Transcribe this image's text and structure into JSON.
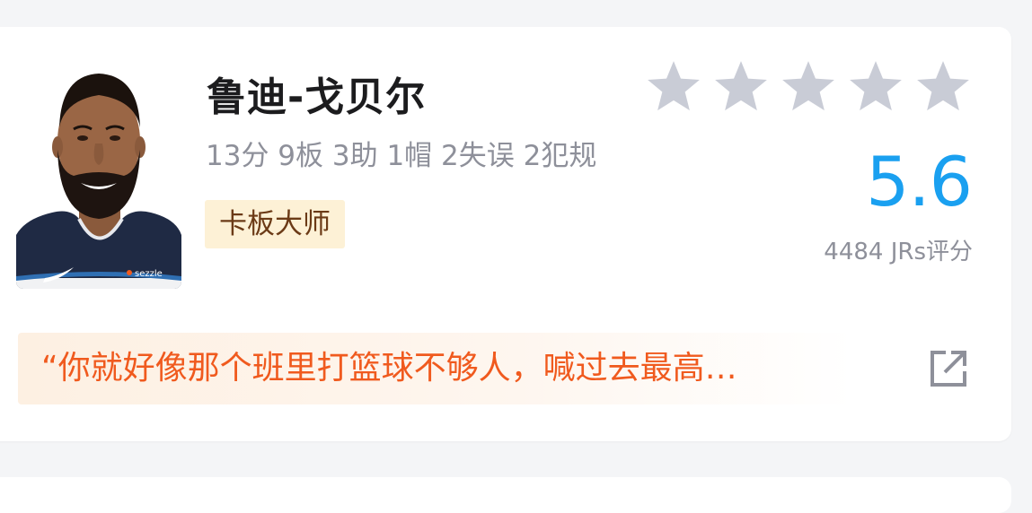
{
  "player": {
    "name": "鲁迪-戈贝尔",
    "stats": "13分 9板 3助 1帽 2失误 2犯规",
    "tag": "卡板大师",
    "jersey_sponsor": "sezzle"
  },
  "rating": {
    "stars_total": 5,
    "stars_filled": 0,
    "score": "5.6",
    "raters": "4484 JRs评分"
  },
  "comment": {
    "text": "“你就好像那个班里打篮球不够人，喊过去最高…"
  },
  "colors": {
    "score": "#1aa0f0",
    "star_empty": "#c9ccd6",
    "quote_text": "#f05a1e",
    "tag_bg": "#fdf1d6",
    "tag_text": "#6b3a16"
  },
  "icons": {
    "star": "star-icon",
    "share": "share-external-icon"
  }
}
